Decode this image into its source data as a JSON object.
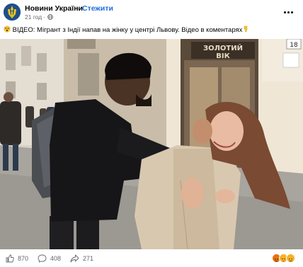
{
  "post": {
    "page_name": "Новини України",
    "separator": "·",
    "follow_label": "Стежити",
    "time": "21 год",
    "time_separator": "·",
    "text": "ВІДЕО: Мігрант з Індії напав на жінку у центрі Львову. Відео в коментарях",
    "leading_emoji": "shocked-face-emoji",
    "trailing_emoji": "pointing-down-hand-emoji"
  },
  "photo": {
    "sign_main": "ЗОЛОТИЙ",
    "sign_sub": "ВІК",
    "house_number": "18"
  },
  "stats": {
    "likes": "870",
    "comments": "408",
    "shares": "271"
  },
  "icons": {
    "like": "thumbs-up-icon",
    "comment": "comment-bubble-icon",
    "share": "share-arrow-icon",
    "more": "more-options-icon",
    "privacy": "globe-icon"
  },
  "colors": {
    "brand_blue": "#216fdb",
    "muted_text": "#65676b",
    "reaction_angry": "#e9710f",
    "reaction_care": "#f7b125",
    "reaction_sad": "#f7b125"
  }
}
